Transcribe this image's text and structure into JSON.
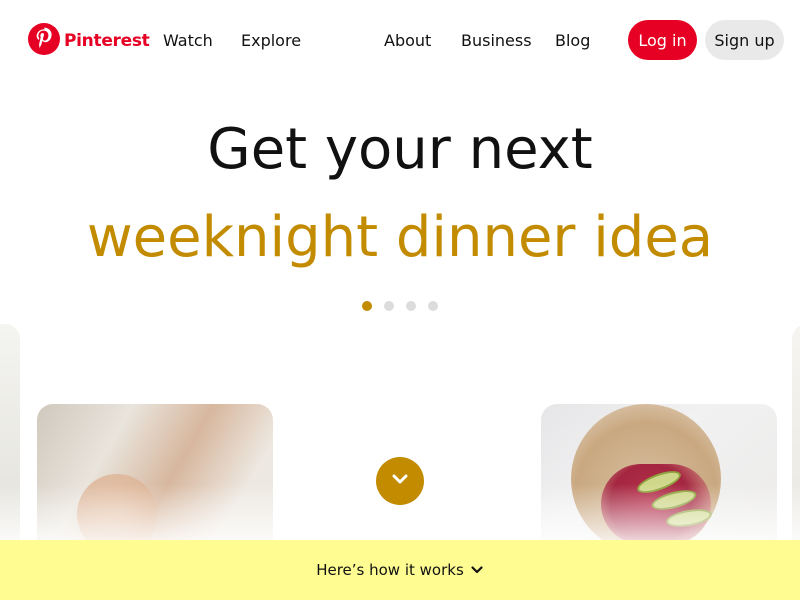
{
  "brand": {
    "name": "Pinterest",
    "color": "#e60023"
  },
  "nav": {
    "left": [
      {
        "label": "Watch"
      },
      {
        "label": "Explore"
      }
    ],
    "right": [
      {
        "label": "About"
      },
      {
        "label": "Business"
      },
      {
        "label": "Blog"
      }
    ],
    "login_label": "Log in",
    "signup_label": "Sign up"
  },
  "hero": {
    "line1": "Get your next",
    "line2": "weeknight dinner idea",
    "accent_color": "#c28b00",
    "carousel": {
      "count": 4,
      "active": 1
    }
  },
  "icons": {
    "logo": "pinterest-logo-icon",
    "scroll": "chevron-down-icon"
  },
  "footer": {
    "label": "Here’s how it works",
    "background": "#fffd92"
  }
}
